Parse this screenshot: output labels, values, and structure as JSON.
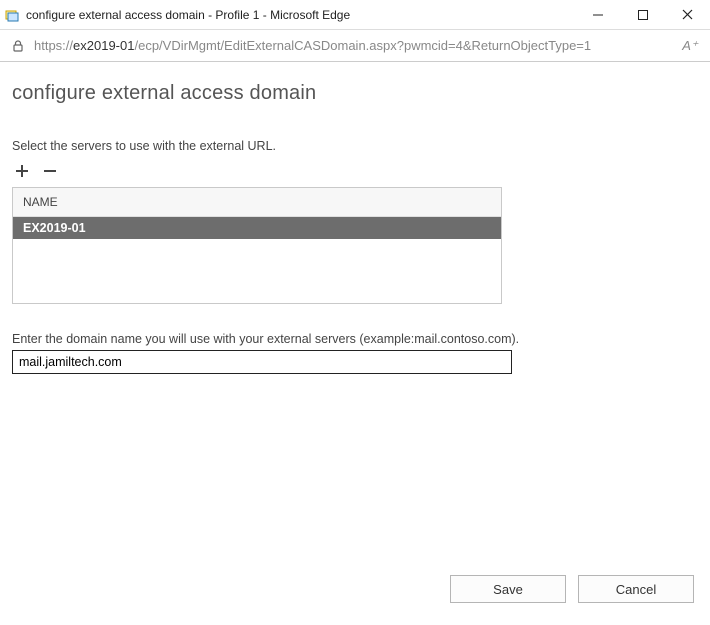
{
  "window": {
    "title": "configure external access domain - Profile 1 - Microsoft Edge"
  },
  "address": {
    "scheme": "https://",
    "host": "ex2019-01",
    "path": "/ecp/VDirMgmt/EditExternalCASDomain.aspx?pwmcid=4&ReturnObjectType=1"
  },
  "page": {
    "title": "configure external access domain",
    "select_instruction": "Select the servers to use with the external URL.",
    "column_header": "NAME",
    "rows": [
      "EX2019-01"
    ],
    "domain_instruction": "Enter the domain name you will use with your external servers (example:mail.contoso.com).",
    "domain_value": "mail.jamiltech.com",
    "save_label": "Save",
    "cancel_label": "Cancel"
  }
}
